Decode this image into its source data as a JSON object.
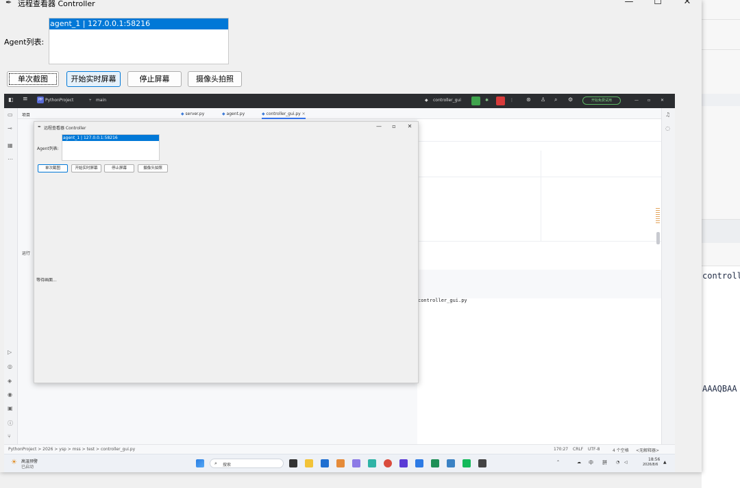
{
  "window": {
    "title": "远程查看器 Controller",
    "icon": "feather-icon",
    "controls": {
      "minimize": "—",
      "maximize": "☐",
      "close": "✕"
    }
  },
  "agent_list": {
    "label": "Agent列表:",
    "items": [
      "agent_1 | 127.0.0.1:58216"
    ],
    "selected_index": 0
  },
  "toolbar": {
    "buttons": [
      "单次截图",
      "开始实时屏幕",
      "停止屏幕",
      "摄像头拍照"
    ]
  },
  "background_window": {
    "texts": [
      "controlle",
      "AAAQBAA"
    ]
  },
  "canvas": {
    "ide": {
      "project": "PythonProject",
      "project_badge": "PP",
      "branch": "main",
      "run_config": "controller_gui",
      "trial_button": "开始免费试用",
      "project_panel": "项目",
      "run_panel": "运行",
      "tabs": [
        "server.py",
        "agent.py",
        "controller_gui.py"
      ],
      "editor_text": "controller_gui.py",
      "breadcrumb": [
        "PythonProject",
        "2026",
        "ysp",
        "mss",
        "test",
        "controller_gui.py"
      ],
      "status": {
        "position": "170:27",
        "line_sep": "CRLF",
        "encoding": "UTF-8",
        "indent": "4 个空格",
        "interpreter": "<无解释器>"
      }
    },
    "nested_window": {
      "title": "远程查看器 Controller",
      "agent_label": "Agent列表:",
      "agent_item": "agent_1 | 127.0.0.1:58216",
      "buttons": [
        "单次截图",
        "开始实时屏幕",
        "停止屏幕",
        "摄像头拍照"
      ],
      "status": "等待画面..."
    },
    "taskbar": {
      "weather_title": "高温预警",
      "weather_sub": "已启动",
      "search_placeholder": "搜索",
      "ime": "中",
      "ime2": "拼",
      "time": "18:56",
      "date": "2026/8/6"
    }
  },
  "colors": {
    "selection": "#0078d7",
    "ide_header": "#2b2d30",
    "accent": "#3574f0"
  }
}
